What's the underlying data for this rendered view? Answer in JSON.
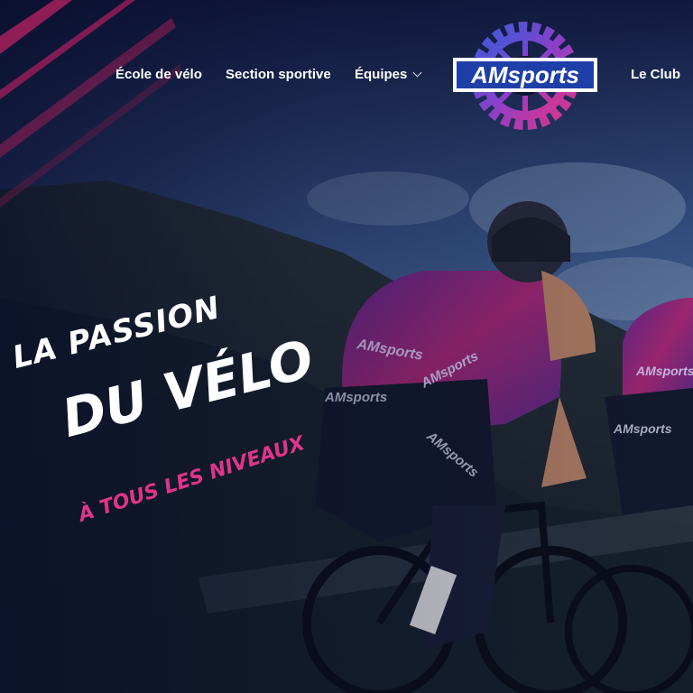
{
  "nav": {
    "items": [
      {
        "label": "École de vélo"
      },
      {
        "label": "Section sportive"
      },
      {
        "label": "Équipes"
      },
      {
        "label": "Le Club"
      }
    ]
  },
  "logo": {
    "text": "AMsports",
    "icon": "gear-icon"
  },
  "hero": {
    "line1": "LA PASSION",
    "line2": "DU VÉLO",
    "line3": "À TOUS LES NIVEAUX",
    "jersey_text": "AMsports"
  },
  "colors": {
    "brand_pink": "#e0348a",
    "brand_magenta": "#c2185b",
    "brand_blue": "#3a5bd9",
    "background": "#0d1432",
    "nav_text": "#ffffff"
  }
}
